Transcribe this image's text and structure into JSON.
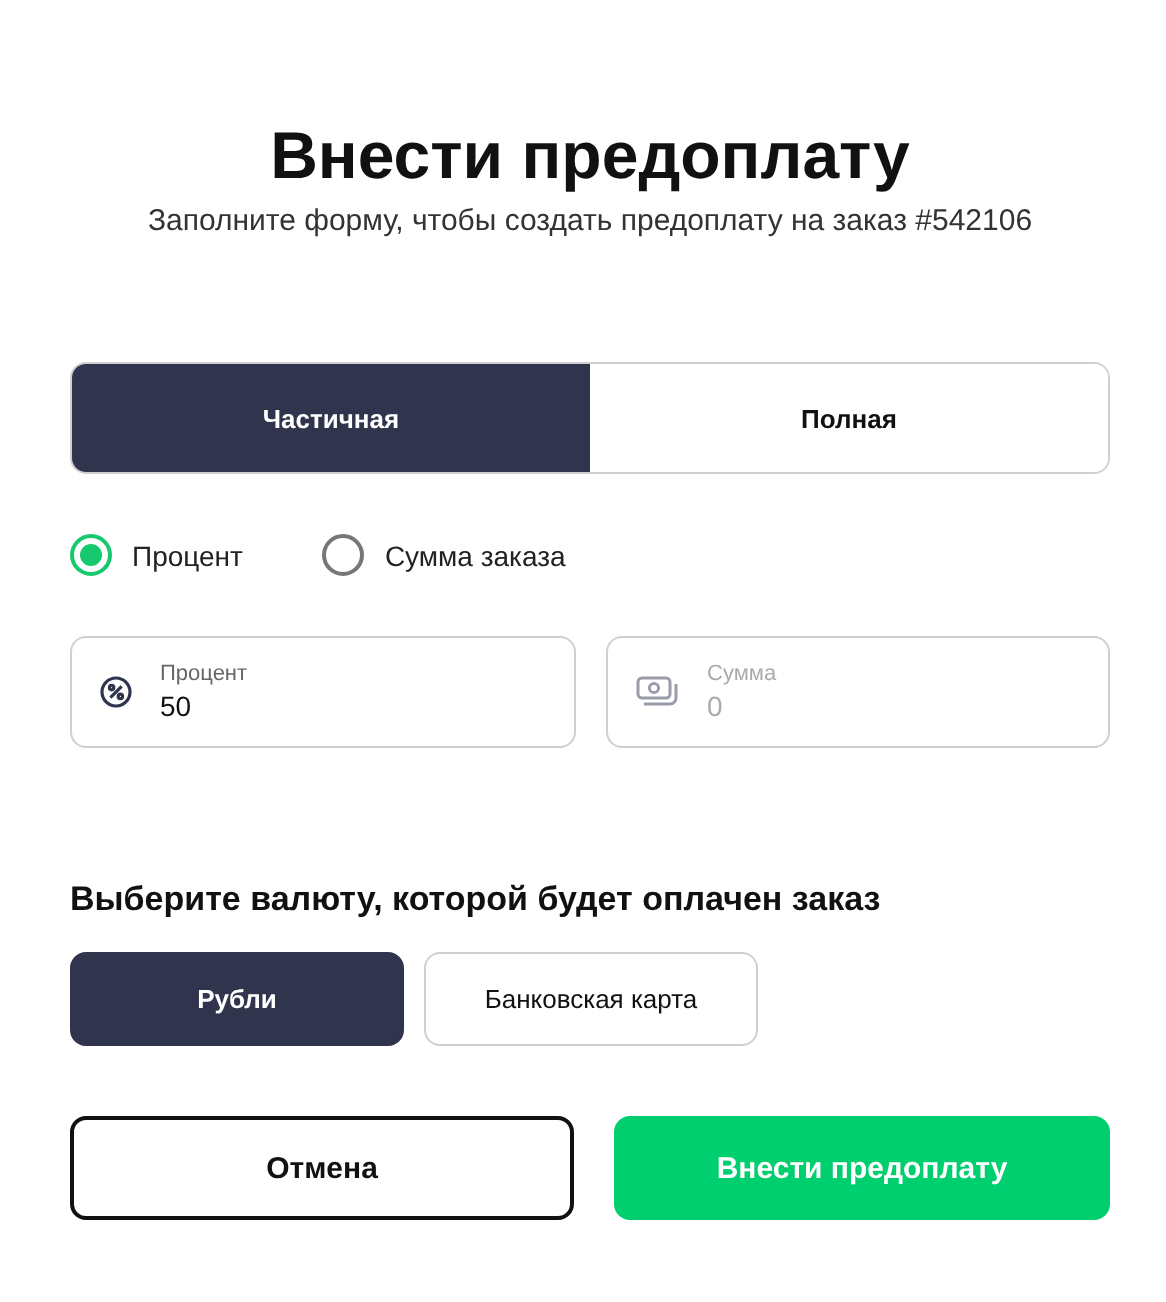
{
  "title": "Внести предоплату",
  "subtitle": "Заполните форму, чтобы создать предоплату на заказ #542106",
  "payment_type": [
    {
      "label": "Частичная",
      "selected": true
    },
    {
      "label": "Полная",
      "selected": false
    }
  ],
  "mode": [
    {
      "label": "Процент",
      "selected": true
    },
    {
      "label": "Сумма заказа",
      "selected": false
    }
  ],
  "fields": [
    {
      "kind": "percent",
      "label": "Процент",
      "value": "50",
      "disabled": false
    },
    {
      "kind": "money",
      "label": "Сумма",
      "value": "0",
      "disabled": true
    }
  ],
  "currency_heading": "Выберите валюту, которой будет оплачен заказ",
  "currency": [
    {
      "label": "Рубли",
      "selected": true
    },
    {
      "label": "Банковская карта",
      "selected": false
    }
  ],
  "buttons": [
    {
      "kind": "secondary",
      "label": "Отмена"
    },
    {
      "kind": "primary",
      "label": "Внести предоплату"
    }
  ]
}
